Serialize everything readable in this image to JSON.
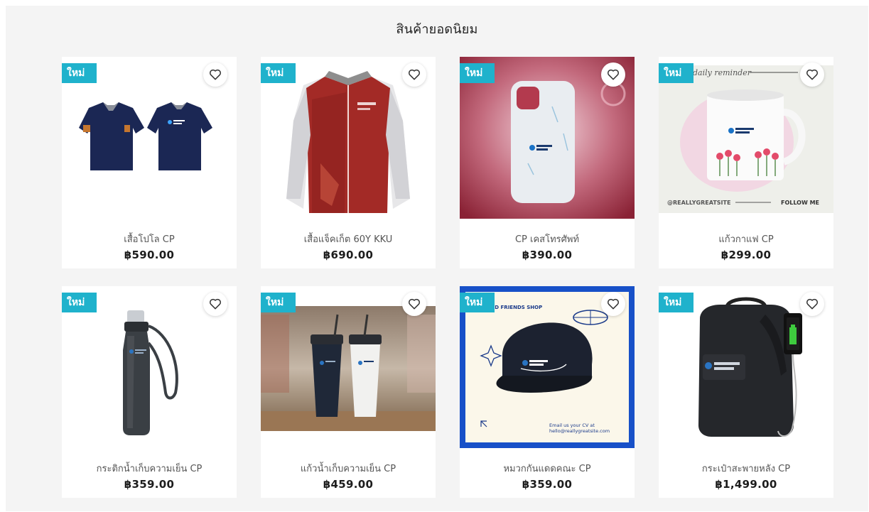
{
  "section": {
    "title": "สินค้ายอดนิยม"
  },
  "badge_color": "#1fb2cc",
  "products": [
    {
      "name": "เสื้อโปโล CP",
      "price": "฿590.00",
      "badge": "ใหม่",
      "image": "polo-shirt-image"
    },
    {
      "name": "เสื้อแจ็คเก็ต 60Y KKU",
      "price": "฿690.00",
      "badge": "ใหม่",
      "image": "jacket-image"
    },
    {
      "name": "CP เคสโทรศัพท์",
      "price": "฿390.00",
      "badge": "ใหม่",
      "image": "phone-case-image"
    },
    {
      "name": "แก้วกาแฟ CP",
      "price": "฿299.00",
      "badge": "ใหม่",
      "image": "mug-image",
      "image_text": {
        "reminder": "daily reminder",
        "site": "@REALLYGREATSITE",
        "follow": "FOLLOW ME"
      }
    },
    {
      "name": "กระติกน้ำเก็บความเย็น CP",
      "price": "฿359.00",
      "badge": "ใหม่",
      "image": "water-bottle-image"
    },
    {
      "name": "แก้วน้ำเก็บความเย็น CP",
      "price": "฿459.00",
      "badge": "ใหม่",
      "image": "tumbler-image"
    },
    {
      "name": "หมวกกันแดดคณะ CP",
      "price": "฿359.00",
      "badge": "ใหม่",
      "image": "cap-image",
      "image_text": {
        "shop": "AND FRIENDS SHOP",
        "email1": "Email us your CV at",
        "email2": "hello@reallygreatsite.com"
      }
    },
    {
      "name": "กระเป๋าสะพายหลัง CP",
      "price": "฿1,499.00",
      "badge": "ใหม่",
      "image": "backpack-image"
    }
  ]
}
